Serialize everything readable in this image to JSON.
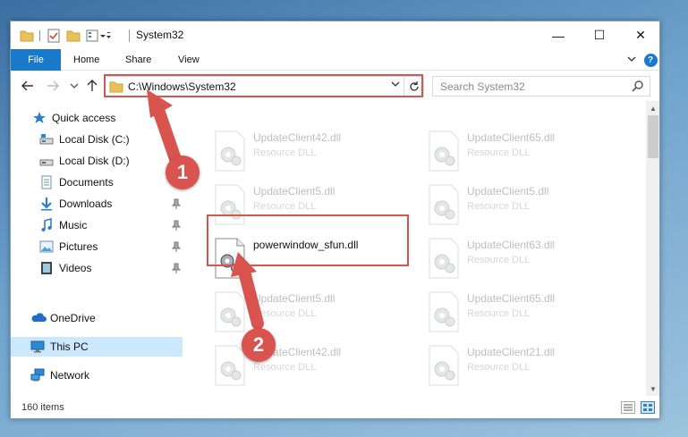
{
  "window": {
    "title": "System32",
    "controls": {
      "minimize": "—",
      "maximize": "☐",
      "close": "✕"
    }
  },
  "ribbon": {
    "tabs": [
      {
        "label": "File"
      },
      {
        "label": "Home"
      },
      {
        "label": "Share"
      },
      {
        "label": "View"
      }
    ],
    "help": "?"
  },
  "navigation": {
    "address": "C:\\Windows\\System32",
    "search_placeholder": "Search System32"
  },
  "sidebar": {
    "items": [
      {
        "label": "Quick access",
        "icon": "star-icon"
      },
      {
        "label": "Local Disk (C:)",
        "icon": "drive-icon"
      },
      {
        "label": "Local Disk (D:)",
        "icon": "drive-icon"
      },
      {
        "label": "Documents",
        "icon": "document-icon"
      },
      {
        "label": "Downloads",
        "icon": "download-icon"
      },
      {
        "label": "Music",
        "icon": "music-icon"
      },
      {
        "label": "Pictures",
        "icon": "pictures-icon"
      },
      {
        "label": "Videos",
        "icon": "video-icon"
      },
      {
        "label": "OneDrive",
        "icon": "cloud-icon"
      },
      {
        "label": "This PC",
        "icon": "computer-icon"
      },
      {
        "label": "Network",
        "icon": "network-icon"
      }
    ]
  },
  "files": [
    {
      "name": "UpdateClient42.dll",
      "type": "Resource DLL"
    },
    {
      "name": "UpdateClient65.dll",
      "type": "Resource DLL"
    },
    {
      "name": "UpdateClient5.dll",
      "type": "Resource DLL"
    },
    {
      "name": "UpdateClient5.dll",
      "type": "Resource DLL"
    },
    {
      "name": "powerwindow_sfun.dll",
      "type": ""
    },
    {
      "name": "UpdateClient63.dll",
      "type": "Resource DLL"
    },
    {
      "name": "UpdateClient5.dll",
      "type": "Resource DLL"
    },
    {
      "name": "UpdateClient65.dll",
      "type": "Resource DLL"
    },
    {
      "name": "UpdateClient42.dll",
      "type": "Resource DLL"
    },
    {
      "name": "UpdateClient21.dll",
      "type": "Resource DLL"
    }
  ],
  "status": {
    "item_count": "160 items"
  },
  "annotations": {
    "step1": "1",
    "step2": "2",
    "color": "#d9534f"
  }
}
